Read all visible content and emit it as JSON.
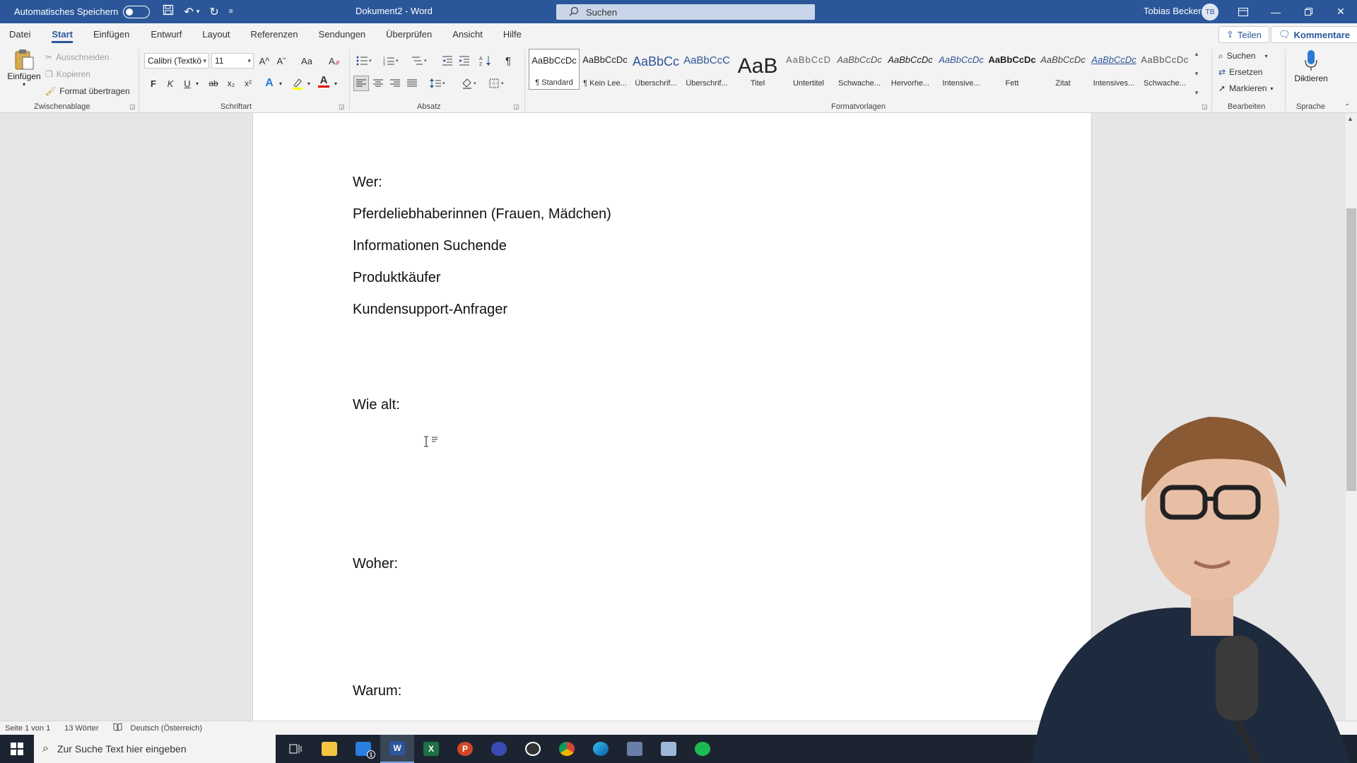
{
  "titlebar": {
    "autosave_label": "Automatisches Speichern",
    "document_title": "Dokument2  -  Word",
    "search_placeholder": "Suchen",
    "user_name": "Tobias Becker",
    "user_initials": "TB"
  },
  "tabs": [
    "Datei",
    "Start",
    "Einfügen",
    "Entwurf",
    "Layout",
    "Referenzen",
    "Sendungen",
    "Überprüfen",
    "Ansicht",
    "Hilfe"
  ],
  "active_tab": "Start",
  "header_buttons": {
    "share": "Teilen",
    "comments": "Kommentare"
  },
  "clipboard": {
    "label": "Zwischenablage",
    "paste": "Einfügen",
    "cut": "Ausschneiden",
    "copy": "Kopieren",
    "format_painter": "Format übertragen"
  },
  "font": {
    "label": "Schriftart",
    "font_name": "Calibri (Textkö",
    "font_size": "11",
    "bold": "F",
    "italic": "K",
    "underline": "U",
    "strikethrough": "ab",
    "subscript": "x₂",
    "superscript": "x²",
    "grow": "A^",
    "shrink": "Aˇ",
    "case": "Aa",
    "text_effects": "A",
    "font_color": "A"
  },
  "paragraph": {
    "label": "Absatz"
  },
  "styles": {
    "label": "Formatvorlagen",
    "items": [
      {
        "preview": "AaBbCcDc",
        "name": "¶ Standard",
        "selected": true
      },
      {
        "preview": "AaBbCcDc",
        "name": "¶ Kein Lee..."
      },
      {
        "preview": "AaBbCc",
        "name": "Überschrif..."
      },
      {
        "preview": "AaBbCcC",
        "name": "Überschrif..."
      },
      {
        "preview": "AaB",
        "name": "Titel"
      },
      {
        "preview": "AaBbCcD",
        "name": "Untertitel"
      },
      {
        "preview": "AaBbCcDc",
        "name": "Schwache..."
      },
      {
        "preview": "AaBbCcDc",
        "name": "Hervorhe..."
      },
      {
        "preview": "AaBbCcDc",
        "name": "Intensive..."
      },
      {
        "preview": "AaBbCcDc",
        "name": "Fett"
      },
      {
        "preview": "AaBbCcDc",
        "name": "Zitat"
      },
      {
        "preview": "AaBbCcDc",
        "name": "Intensives..."
      },
      {
        "preview": "AaBbCcDc",
        "name": "Schwache..."
      }
    ]
  },
  "editing": {
    "label": "Bearbeiten",
    "find": "Suchen",
    "replace": "Ersetzen",
    "select": "Markieren"
  },
  "voice": {
    "label": "Sprache",
    "dictate": "Diktieren"
  },
  "document": {
    "lines": [
      "Wer:",
      "Pferdeliebhaberinnen (Frauen, Mädchen)",
      "Informationen Suchende",
      "Produktkäufer",
      "Kundensupport-Anfrager",
      "Wie alt:",
      "Woher:",
      "Warum:"
    ]
  },
  "statusbar": {
    "page": "Seite 1 von 1",
    "words": "13 Wörter",
    "language": "Deutsch (Österreich)"
  },
  "taskbar": {
    "search_placeholder": "Zur Suche Text hier eingeben",
    "mail_badge": "1"
  },
  "colors": {
    "word_blue": "#2b579a",
    "ribbon_bg": "#f3f3f3",
    "taskbar_bg": "#1c2431"
  }
}
